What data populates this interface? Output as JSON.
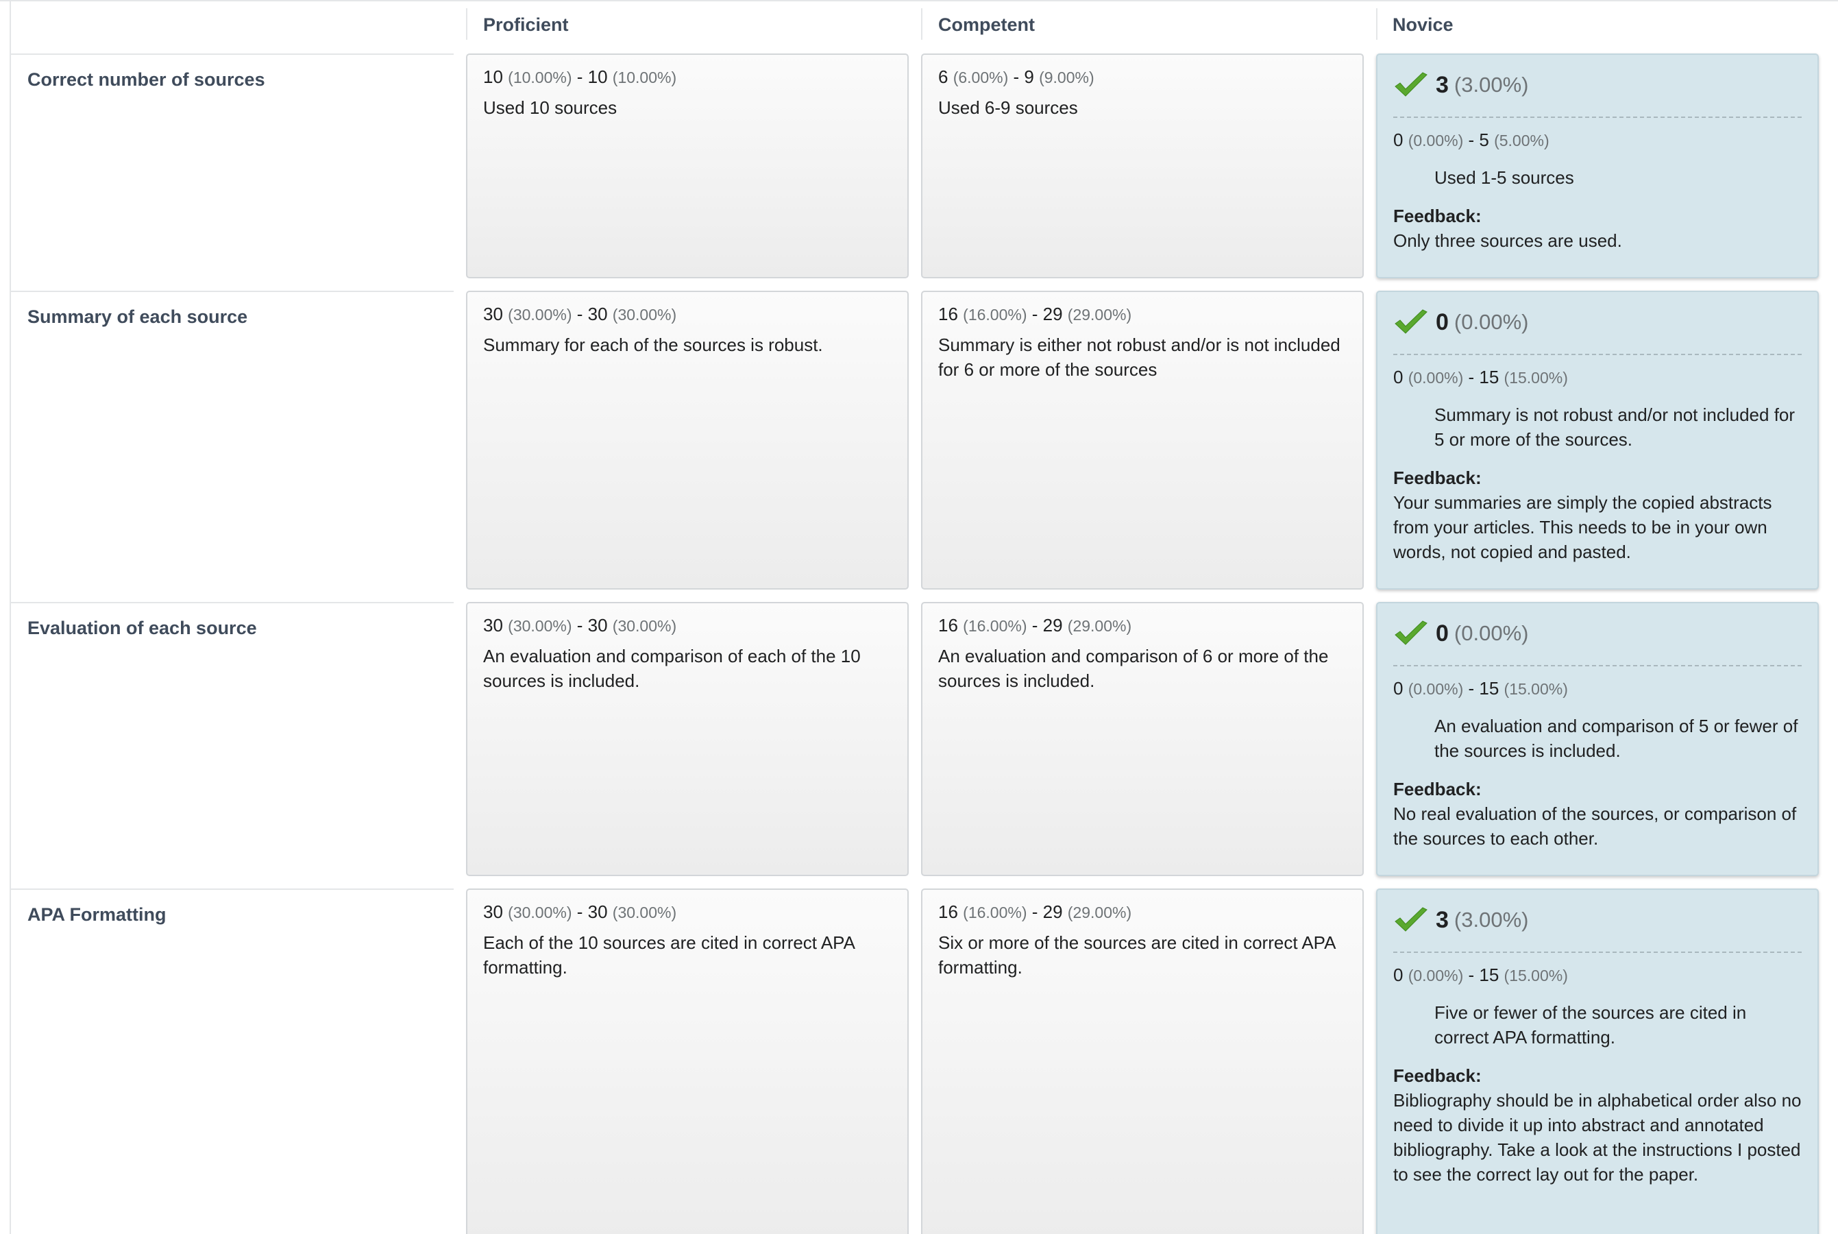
{
  "columns": {
    "proficient": "Proficient",
    "competent": "Competent",
    "novice": "Novice"
  },
  "feedback_label": "Feedback:",
  "colors": {
    "selected_cell_bg": "#d6e6ec",
    "header_text": "#3f4b5b",
    "check_green": "#5aa82f"
  },
  "rows": [
    {
      "criterion": "Correct number of sources",
      "proficient": {
        "min": "10",
        "min_pct": "(10.00%)",
        "max": "10",
        "max_pct": "(10.00%)",
        "desc": "Used 10 sources"
      },
      "competent": {
        "min": "6",
        "min_pct": "(6.00%)",
        "max": "9",
        "max_pct": "(9.00%)",
        "desc": "Used 6-9 sources"
      },
      "novice": {
        "score": "3",
        "score_pct": "(3.00%)",
        "min": "0",
        "min_pct": "(0.00%)",
        "max": "5",
        "max_pct": "(5.00%)",
        "desc": "Used 1-5 sources",
        "feedback": "Only three sources are used."
      }
    },
    {
      "criterion": "Summary of each source",
      "proficient": {
        "min": "30",
        "min_pct": "(30.00%)",
        "max": "30",
        "max_pct": "(30.00%)",
        "desc": "Summary for each of the sources is robust."
      },
      "competent": {
        "min": "16",
        "min_pct": "(16.00%)",
        "max": "29",
        "max_pct": "(29.00%)",
        "desc": "Summary is either not robust and/or is not included for 6 or more of the sources"
      },
      "novice": {
        "score": "0",
        "score_pct": "(0.00%)",
        "min": "0",
        "min_pct": "(0.00%)",
        "max": "15",
        "max_pct": "(15.00%)",
        "desc": "Summary is not robust and/or not included for 5 or more of the sources.",
        "feedback": "Your summaries are simply the copied abstracts from your articles. This needs to be in your own words, not copied and pasted."
      }
    },
    {
      "criterion": "Evaluation of each source",
      "proficient": {
        "min": "30",
        "min_pct": "(30.00%)",
        "max": "30",
        "max_pct": "(30.00%)",
        "desc": "An evaluation and comparison of each of the 10 sources is included."
      },
      "competent": {
        "min": "16",
        "min_pct": "(16.00%)",
        "max": "29",
        "max_pct": "(29.00%)",
        "desc": "An evaluation and comparison of 6 or more of the sources is included."
      },
      "novice": {
        "score": "0",
        "score_pct": "(0.00%)",
        "min": "0",
        "min_pct": "(0.00%)",
        "max": "15",
        "max_pct": "(15.00%)",
        "desc": "An evaluation and comparison of 5 or fewer of the sources is included.",
        "feedback": "No real evaluation of the sources, or comparison of the sources to each other."
      }
    },
    {
      "criterion": "APA Formatting",
      "proficient": {
        "min": "30",
        "min_pct": "(30.00%)",
        "max": "30",
        "max_pct": "(30.00%)",
        "desc": "Each of the 10 sources are cited in correct APA formatting."
      },
      "competent": {
        "min": "16",
        "min_pct": "(16.00%)",
        "max": "29",
        "max_pct": "(29.00%)",
        "desc": "Six or more of the sources are cited in correct APA formatting."
      },
      "novice": {
        "score": "3",
        "score_pct": "(3.00%)",
        "min": "0",
        "min_pct": "(0.00%)",
        "max": "15",
        "max_pct": "(15.00%)",
        "desc": "Five or fewer of the sources are cited in correct APA formatting.",
        "feedback": "Bibliography should be in alphabetical order also no need to divide it up into abstract and annotated bibliography. Take a look at the instructions I posted to see the correct lay out for the paper."
      }
    }
  ]
}
